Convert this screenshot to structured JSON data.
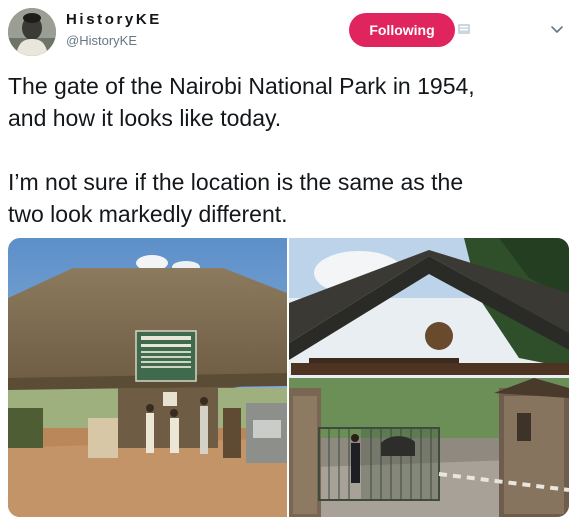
{
  "author": {
    "name": "HistoryKE",
    "handle": "@HistoryKE"
  },
  "follow_button": {
    "label": "Following"
  },
  "tweet": {
    "text": "The gate of the Nairobi National Park in 1954,\nand how it looks like today.\n\nI’m not sure if the location is the same as the\ntwo look markedly different."
  },
  "media": {
    "left_sign_text": "NAIROBI\nNATIONAL PARK"
  },
  "colors": {
    "follow_button_bg": "#e0245e",
    "handle_text": "#657786"
  },
  "icons": {
    "more": "chevron-down-icon"
  }
}
